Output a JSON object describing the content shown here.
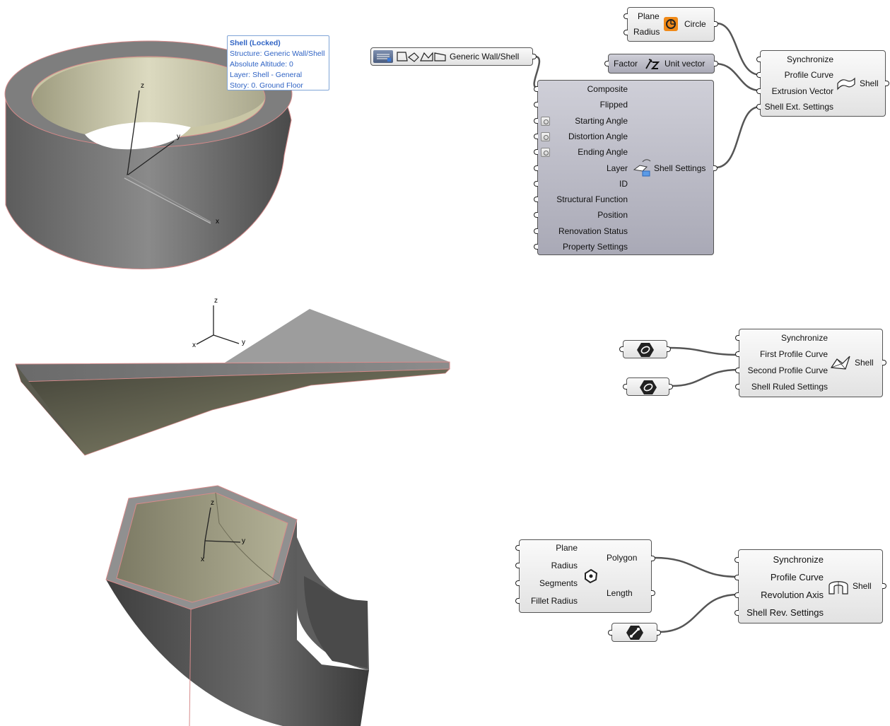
{
  "tooltip": {
    "title": "Shell (Locked)",
    "structure": "Structure: Generic Wall/Shell",
    "altitude": "Absolute Altitude: 0",
    "layer": "Layer: Shell - General",
    "story": "Story: 0. Ground Floor"
  },
  "axes": {
    "x": "x",
    "y": "y",
    "z": "z"
  },
  "circle_node": {
    "inputs": [
      "Plane",
      "Radius"
    ],
    "output": "Circle"
  },
  "unit_vector_node": {
    "input": "Factor",
    "output": "Unit vector"
  },
  "wall_shell_param": {
    "label": "Generic Wall/Shell"
  },
  "shell_settings_node": {
    "inputs": [
      "Composite",
      "Flipped",
      "Starting Angle",
      "Distortion Angle",
      "Ending Angle",
      "Layer",
      "ID",
      "Structural Function",
      "Position",
      "Renovation Status",
      "Property Settings"
    ],
    "output": "Shell Settings"
  },
  "shell_extrude_node": {
    "inputs": [
      "Synchronize",
      "Profile Curve",
      "Extrusion Vector",
      "Shell Ext. Settings"
    ],
    "output": "Shell"
  },
  "shell_ruled_node": {
    "inputs": [
      "Synchronize",
      "First Profile Curve",
      "Second Profile Curve",
      "Shell Ruled Settings"
    ],
    "output": "Shell"
  },
  "polygon_node": {
    "inputs": [
      "Plane",
      "Radius",
      "Segments",
      "Fillet Radius"
    ],
    "outputs": [
      "Polygon",
      "Length"
    ]
  },
  "shell_revolve_node": {
    "inputs": [
      "Synchronize",
      "Profile Curve",
      "Revolution Axis",
      "Shell Rev. Settings"
    ],
    "output": "Shell"
  }
}
